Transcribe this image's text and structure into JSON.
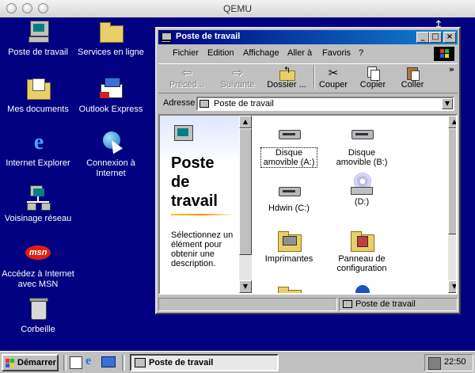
{
  "host": {
    "title": "QEMU"
  },
  "desktop_icons": [
    {
      "label": "Poste de travail",
      "icon": "my-computer-icon"
    },
    {
      "label": "Services en ligne",
      "icon": "folder-icon"
    },
    {
      "label": "Mes documents",
      "icon": "my-documents-icon"
    },
    {
      "label": "Outlook Express",
      "icon": "outlook-express-icon"
    },
    {
      "label": "Internet Explorer",
      "icon": "internet-explorer-icon"
    },
    {
      "label": "Connexion à Internet",
      "icon": "connect-internet-icon"
    },
    {
      "label": "Voisinage réseau",
      "icon": "network-neighborhood-icon"
    },
    {
      "label": "Accédez à Internet avec MSN",
      "icon": "msn-icon"
    },
    {
      "label": "Corbeille",
      "icon": "recycle-bin-icon"
    }
  ],
  "window": {
    "title": "Poste de travail",
    "controls": {
      "minimize": "_",
      "maximize": "□",
      "close": "×"
    },
    "menu": [
      "Fichier",
      "Edition",
      "Affichage",
      "Aller à",
      "Favoris",
      "?"
    ],
    "toolbar": [
      {
        "label": "Précéd...",
        "icon": "back-arrow-icon",
        "disabled": true
      },
      {
        "label": "Suivante",
        "icon": "forward-arrow-icon",
        "disabled": true
      },
      {
        "label": "Dossier ...",
        "icon": "up-folder-icon",
        "disabled": false
      },
      {
        "label": "Couper",
        "icon": "scissors-icon",
        "disabled": false
      },
      {
        "label": "Copier",
        "icon": "copy-icon",
        "disabled": false
      },
      {
        "label": "Coller",
        "icon": "paste-icon",
        "disabled": false
      }
    ],
    "toolbar_more": "»",
    "address": {
      "label": "Adresse",
      "value": "Poste de travail"
    },
    "left_pane": {
      "title_lines": [
        "Poste",
        "de",
        "travail"
      ],
      "description": "Sélectionnez un élément pour obtenir une description."
    },
    "items": [
      {
        "label": "Disque amovible (A:)",
        "icon": "removable-disk-icon"
      },
      {
        "label": "Disque amovible (B:)",
        "icon": "removable-disk-icon"
      },
      {
        "label": "Hdwin (C:)",
        "icon": "hard-disk-icon"
      },
      {
        "label": "(D:)",
        "icon": "cd-drive-icon"
      },
      {
        "label": "Imprimantes",
        "icon": "printers-folder-icon"
      },
      {
        "label": "Panneau de configuration",
        "icon": "control-panel-icon"
      }
    ],
    "status": "Poste de travail"
  },
  "taskbar": {
    "start_label": "Démarrer",
    "task_label": "Poste de travail",
    "clock": "22:50"
  },
  "colors": {
    "desktop": "#000080",
    "titlebar": "#000080",
    "face": "#c0c0c0"
  }
}
